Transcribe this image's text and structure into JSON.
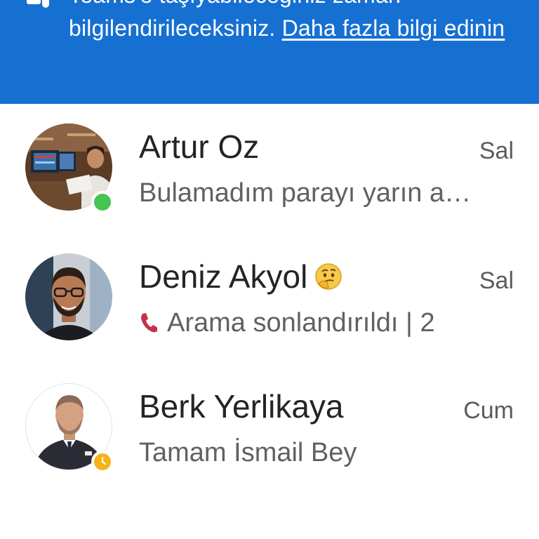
{
  "banner": {
    "line1": "Teams'e taşıyabileceğiniz zaman",
    "line2_prefix": "bilgilendirileceksiniz. ",
    "link_text": "Daha fazla bilgi edinin",
    "icon": "teams-icon",
    "bg_color": "#1670d2"
  },
  "chats": [
    {
      "name": "Artur Oz",
      "time": "Sal",
      "preview": "Bulamadım parayı yarın akşam",
      "presence": "available",
      "avatar": "photo-avatar"
    },
    {
      "name": "Deniz Akyol",
      "status_emoji": "thinking-emoji",
      "time": "Sal",
      "preview_icon": "phone-icon",
      "preview": "Arama sonlandırıldı | 2",
      "avatar": "photo-avatar"
    },
    {
      "name": "Berk Yerlikaya",
      "time": "Cum",
      "preview": "Tamam İsmail Bey",
      "presence": "away",
      "avatar": "photo-avatar"
    }
  ],
  "colors": {
    "available": "#44c451",
    "away": "#f5b21a",
    "call_icon": "#c4314b"
  }
}
